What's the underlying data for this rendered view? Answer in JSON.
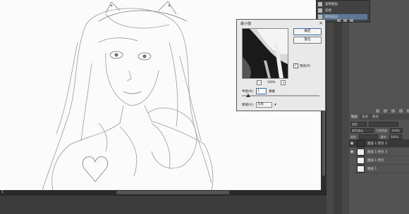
{
  "canvas": {
    "frame_label": "1"
  },
  "history": {
    "items": [
      {
        "label": "复制图层",
        "active": false
      },
      {
        "label": "反相",
        "active": false
      },
      {
        "label": "颜色减淡",
        "active": true
      }
    ]
  },
  "layers": {
    "tabs": [
      "图层",
      "通道",
      "路径"
    ],
    "kind_filter": "类型",
    "blend_mode": "颜色减淡",
    "opacity_label": "不透明度:",
    "opacity": "100%",
    "lock_label": "锁定:",
    "fill_label": "填充:",
    "fill": "100%",
    "items": [
      {
        "name": "图层 1 拷贝 2",
        "selected": true,
        "visible": true,
        "dark": true
      },
      {
        "name": "图层 1 拷贝 3",
        "selected": false,
        "visible": true,
        "dark": false
      },
      {
        "name": "图层 1 拷贝",
        "selected": false,
        "visible": false,
        "dark": false
      },
      {
        "name": "图层 1",
        "selected": false,
        "visible": false,
        "dark": false
      }
    ]
  },
  "dialog": {
    "title": "最小值",
    "ok_label": "确定",
    "cancel_label": "复位",
    "preview_label": "预览(P)",
    "preview_checked": "✓",
    "zoom_level": "100%",
    "zoom_out": "−",
    "zoom_in": "+",
    "radius_label": "半径(R):",
    "radius_value": "1",
    "radius_unit": "像素",
    "preserve_label": "保留(V):",
    "preserve_value": "方形"
  }
}
